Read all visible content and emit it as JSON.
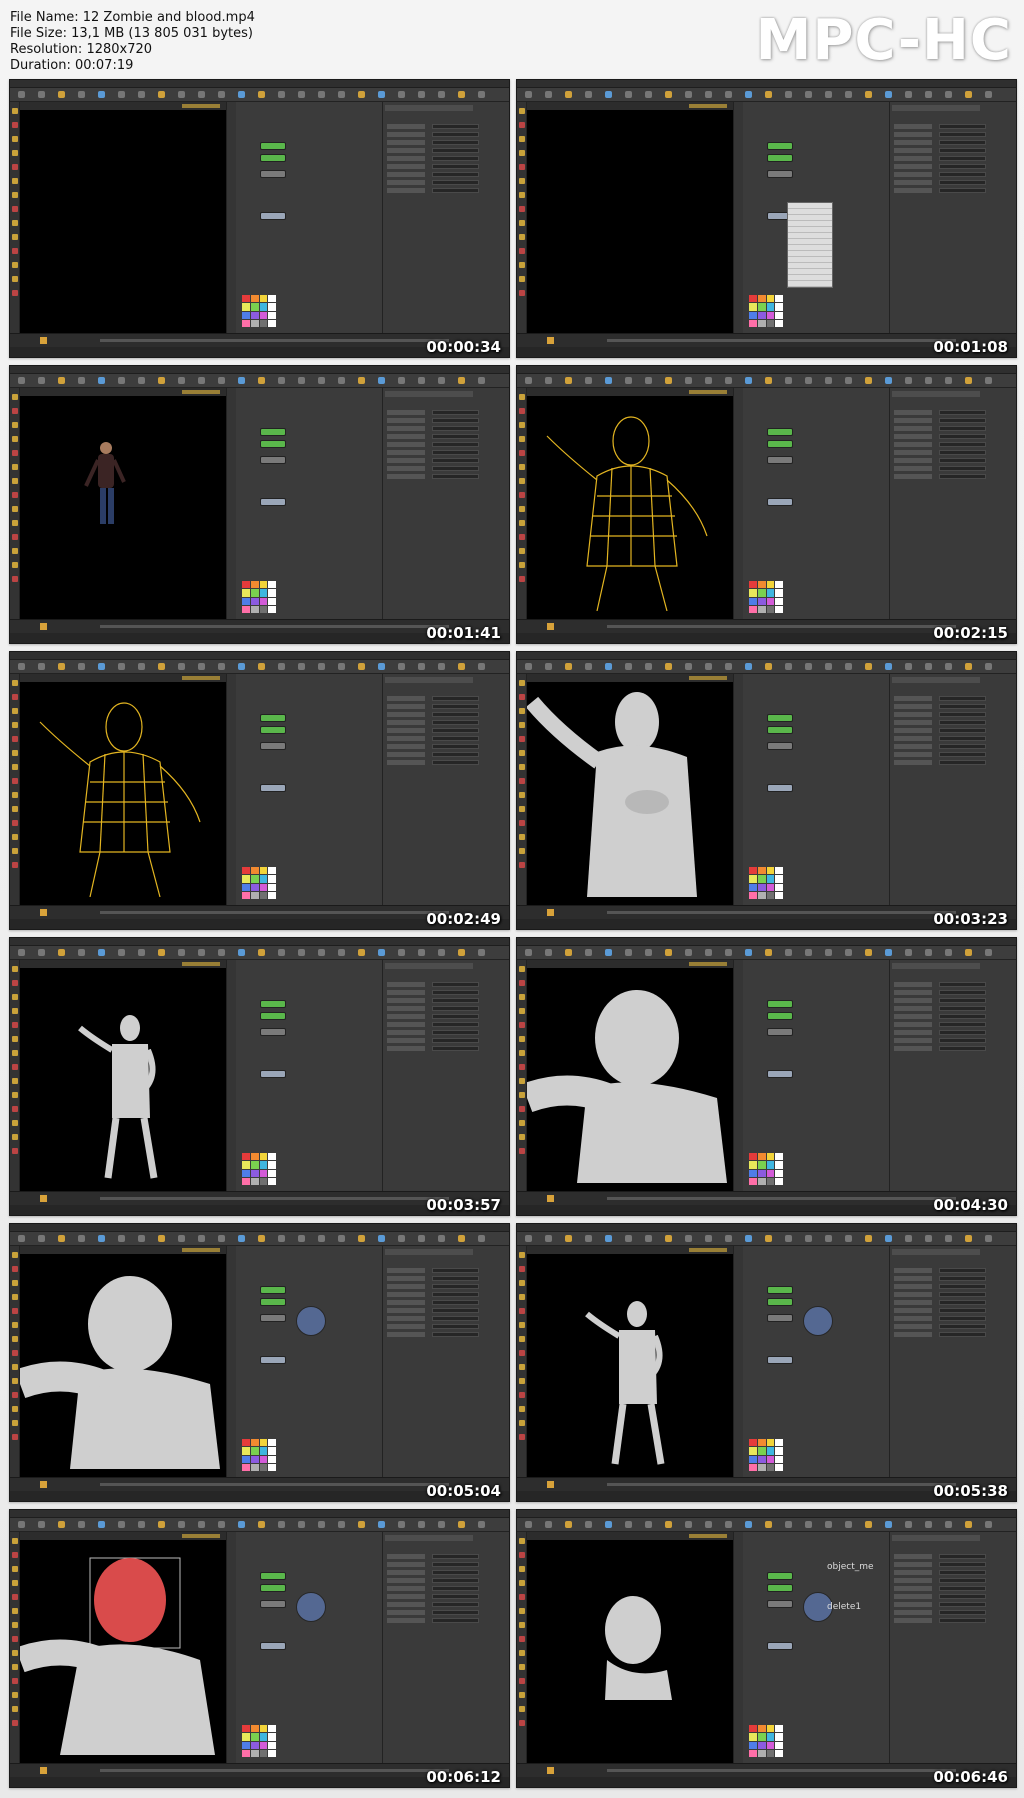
{
  "header": {
    "file_name": "File Name: 12 Zombie and blood.mp4",
    "file_size": "File Size: 13,1 MB (13 805 031 bytes)",
    "resolution": "Resolution: 1280x720",
    "duration": "Duration: 00:07:19",
    "brand": "MPC-HC"
  },
  "thumbnails": [
    {
      "time": "00:00:34",
      "scene": "black"
    },
    {
      "time": "00:01:08",
      "scene": "black-menu"
    },
    {
      "time": "00:01:41",
      "scene": "man"
    },
    {
      "time": "00:02:15",
      "scene": "wireframe"
    },
    {
      "time": "00:02:49",
      "scene": "wireframe"
    },
    {
      "time": "00:03:23",
      "scene": "grey-close"
    },
    {
      "time": "00:03:57",
      "scene": "grey-full"
    },
    {
      "time": "00:04:30",
      "scene": "grey-head"
    },
    {
      "time": "00:05:04",
      "scene": "grey-head"
    },
    {
      "time": "00:05:38",
      "scene": "grey-full"
    },
    {
      "time": "00:06:12",
      "scene": "red-head"
    },
    {
      "time": "00:06:46",
      "scene": "head-only"
    }
  ],
  "node_labels": {
    "thumb12_object": "object_me",
    "thumb12_delete": "delete1"
  },
  "colors": {
    "accent_node": "#5ab74b",
    "wireframe": "#e3b521",
    "shaded_figure": "#cfcfcf",
    "selection": "#d94b4b"
  }
}
